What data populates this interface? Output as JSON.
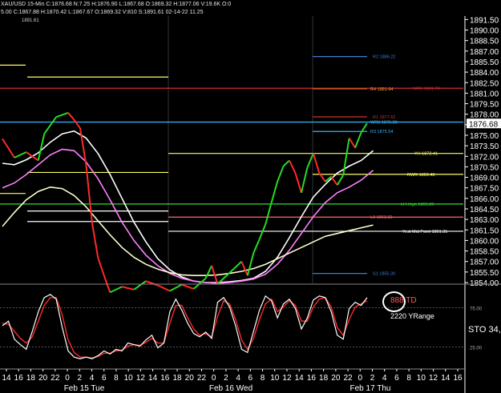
{
  "header": {
    "line1": "XAU/USD  15-Min  C:1876.68  N:7.25  H:1876.90  L:1867.68  O:1869.32  H:1877.06  V:19.6K  O:0",
    "line2": "5.00  C:1867.88  H:1870.42  L:1867.67  O:1869.32  V:810  S:1891.61  02-14-22  11.25",
    "sub_label": "1891.61"
  },
  "chart_data": {
    "type": "line",
    "title": "",
    "symbol": "XAU/USD",
    "timeframe": "15-Min",
    "last_price": "1876.68",
    "y_ticks": [
      "1891.50",
      "1890.00",
      "1888.50",
      "1887.00",
      "1885.50",
      "1884.00",
      "1882.50",
      "1881.00",
      "1879.50",
      "1878.00",
      "1876.50",
      "1875.00",
      "1873.50",
      "1872.00",
      "1870.50",
      "1869.00",
      "1867.50",
      "1866.00",
      "1864.50",
      "1863.00",
      "1861.50",
      "1860.00",
      "1858.50",
      "1857.00",
      "1855.50",
      "1854.00"
    ],
    "ylim": [
      1854.0,
      1892.0
    ],
    "x_ticks": [
      "14",
      "16",
      "18",
      "20",
      "22",
      "0",
      "2",
      "4",
      "6",
      "8",
      "10",
      "12",
      "14",
      "16",
      "18",
      "20",
      "22",
      "0",
      "2",
      "4",
      "6",
      "8",
      "10",
      "12",
      "14",
      "16",
      "18",
      "20",
      "22",
      "0",
      "2",
      "4",
      "6",
      "8",
      "10",
      "12",
      "14",
      "16"
    ],
    "date_labels": [
      "Feb 15 Tue",
      "Feb 16 Wed",
      "Feb 17 Thu"
    ],
    "price_series": [
      {
        "t": 0,
        "p": 1874.5
      },
      {
        "t": 2,
        "p": 1871.8
      },
      {
        "t": 4,
        "p": 1872.6
      },
      {
        "t": 6,
        "p": 1871.4
      },
      {
        "t": 7,
        "p": 1875.2
      },
      {
        "t": 9,
        "p": 1877.6
      },
      {
        "t": 11,
        "p": 1878.2
      },
      {
        "t": 12,
        "p": 1877.2
      },
      {
        "t": 13,
        "p": 1876.0
      },
      {
        "t": 14,
        "p": 1870.8
      },
      {
        "t": 15,
        "p": 1862.5
      },
      {
        "t": 16,
        "p": 1857.5
      },
      {
        "t": 17,
        "p": 1855.0
      },
      {
        "t": 18,
        "p": 1852.6
      },
      {
        "t": 20,
        "p": 1853.4
      },
      {
        "t": 22,
        "p": 1853.0
      },
      {
        "t": 24,
        "p": 1854.2
      },
      {
        "t": 26,
        "p": 1853.6
      },
      {
        "t": 28,
        "p": 1852.8
      },
      {
        "t": 30,
        "p": 1853.7
      },
      {
        "t": 32,
        "p": 1853.1
      },
      {
        "t": 34,
        "p": 1854.6
      },
      {
        "t": 35,
        "p": 1856.4
      },
      {
        "t": 36,
        "p": 1853.8
      },
      {
        "t": 38,
        "p": 1855.4
      },
      {
        "t": 40,
        "p": 1857.0
      },
      {
        "t": 41,
        "p": 1855.0
      },
      {
        "t": 42,
        "p": 1858.2
      },
      {
        "t": 43,
        "p": 1860.2
      },
      {
        "t": 44,
        "p": 1862.3
      },
      {
        "t": 45,
        "p": 1865.4
      },
      {
        "t": 46,
        "p": 1868.4
      },
      {
        "t": 47,
        "p": 1870.6
      },
      {
        "t": 48,
        "p": 1871.4
      },
      {
        "t": 49,
        "p": 1869.6
      },
      {
        "t": 50,
        "p": 1866.8
      },
      {
        "t": 51,
        "p": 1870.4
      },
      {
        "t": 52,
        "p": 1872.4
      },
      {
        "t": 53,
        "p": 1869.6
      },
      {
        "t": 54,
        "p": 1868.4
      },
      {
        "t": 55,
        "p": 1869.1
      },
      {
        "t": 56,
        "p": 1867.9
      },
      {
        "t": 57,
        "p": 1869.3
      },
      {
        "t": 58,
        "p": 1874.6
      },
      {
        "t": 59,
        "p": 1873.2
      },
      {
        "t": 60,
        "p": 1875.4
      },
      {
        "t": 61,
        "p": 1876.7
      }
    ],
    "moving_averages": [
      {
        "color": "#ffffff",
        "values": [
          1871.0,
          1870.8,
          1871.5,
          1872.5,
          1874.0,
          1875.2,
          1875.6,
          1874.6,
          1872.4,
          1869.4,
          1866.0,
          1862.6,
          1859.8,
          1857.4,
          1855.8,
          1854.8,
          1854.2,
          1854.0,
          1854.0,
          1854.1,
          1854.3,
          1854.6,
          1855.6,
          1857.6,
          1860.4,
          1863.4,
          1866.2,
          1868.0,
          1869.6,
          1870.6,
          1871.4,
          1872.8
        ]
      },
      {
        "color": "#ff7fff",
        "values": [
          1867.5,
          1868.2,
          1869.4,
          1870.8,
          1872.2,
          1873.0,
          1872.8,
          1871.2,
          1868.8,
          1865.8,
          1862.6,
          1860.0,
          1857.9,
          1856.4,
          1855.3,
          1854.6,
          1854.2,
          1854.0,
          1853.9,
          1854.0,
          1854.2,
          1854.5,
          1855.2,
          1856.6,
          1858.6,
          1861.0,
          1863.4,
          1865.4,
          1866.8,
          1867.6,
          1868.6,
          1870.0
        ]
      },
      {
        "color": "#ffffcc",
        "values": [
          1862.0,
          1864.0,
          1865.8,
          1867.0,
          1867.6,
          1867.4,
          1866.4,
          1864.8,
          1862.8,
          1860.8,
          1859.0,
          1857.6,
          1856.6,
          1855.9,
          1855.4,
          1855.1,
          1855.0,
          1855.0,
          1855.1,
          1855.3,
          1855.6,
          1856.0,
          1856.6,
          1857.4,
          1858.2,
          1859.0,
          1859.8,
          1860.6,
          1861.0,
          1861.4,
          1861.8,
          1862.2
        ]
      }
    ],
    "levels": [
      {
        "value": 1886.22,
        "color": "#3a7fd5",
        "label": "R2 1886.22"
      },
      {
        "value": 1881.64,
        "color": "#ffd700",
        "label": "R4 1881.64"
      },
      {
        "value": 1881.7,
        "color": "#d03030",
        "label": "WR1 1881.70"
      },
      {
        "value": 1877.62,
        "color": "#d03030",
        "label": "R1 1877.62"
      },
      {
        "value": 1876.88,
        "color": "#2fb6ff",
        "label": "WR3 1876.88"
      },
      {
        "value": 1875.54,
        "color": "#2fb6ff",
        "label": "R3 1875.54"
      },
      {
        "value": 1872.41,
        "color": "#ffff66",
        "label": "YH 1872.41"
      },
      {
        "value": 1869.43,
        "color": "#ffff66",
        "label": "RWR 1869.43"
      },
      {
        "value": 1865.2,
        "color": "#33dd33",
        "label": "LH High 1865.20"
      },
      {
        "value": 1863.33,
        "color": "#ff6b6b",
        "label": "L3 1863.33"
      },
      {
        "value": 1861.31,
        "color": "#ffffff",
        "label": "Yest Mid Point 1861.31"
      },
      {
        "value": 1855.3,
        "color": "#3a7fd5",
        "label": "S1 1855.30"
      }
    ],
    "stochastic": {
      "label": "STO",
      "value": "34,",
      "y_ticks": [
        "25.00",
        "75.00"
      ],
      "k_values": [
        52,
        58,
        35,
        28,
        22,
        45,
        70,
        88,
        92,
        86,
        50,
        20,
        12,
        10,
        12,
        10,
        14,
        20,
        16,
        22,
        20,
        30,
        28,
        26,
        34,
        40,
        24,
        30,
        70,
        86,
        72,
        55,
        42,
        38,
        44,
        36,
        82,
        88,
        76,
        52,
        22,
        18,
        45,
        72,
        90,
        84,
        62,
        80,
        86,
        74,
        48,
        62,
        85,
        90,
        88,
        70,
        40,
        35,
        74,
        82,
        78,
        88
      ],
      "d_values": [
        55,
        54,
        45,
        36,
        30,
        38,
        58,
        78,
        88,
        88,
        66,
        34,
        18,
        12,
        12,
        11,
        13,
        17,
        17,
        20,
        21,
        26,
        28,
        27,
        31,
        36,
        30,
        30,
        55,
        78,
        78,
        62,
        48,
        40,
        42,
        38,
        64,
        84,
        80,
        60,
        34,
        22,
        36,
        60,
        80,
        86,
        70,
        76,
        84,
        78,
        58,
        58,
        76,
        86,
        88,
        76,
        50,
        40,
        60,
        76,
        80,
        84
      ]
    },
    "annotations": [
      {
        "text": "888 TD",
        "color": "#ff5a5a"
      },
      {
        "text": "2220 YRange",
        "color": "#ffffff"
      }
    ]
  }
}
